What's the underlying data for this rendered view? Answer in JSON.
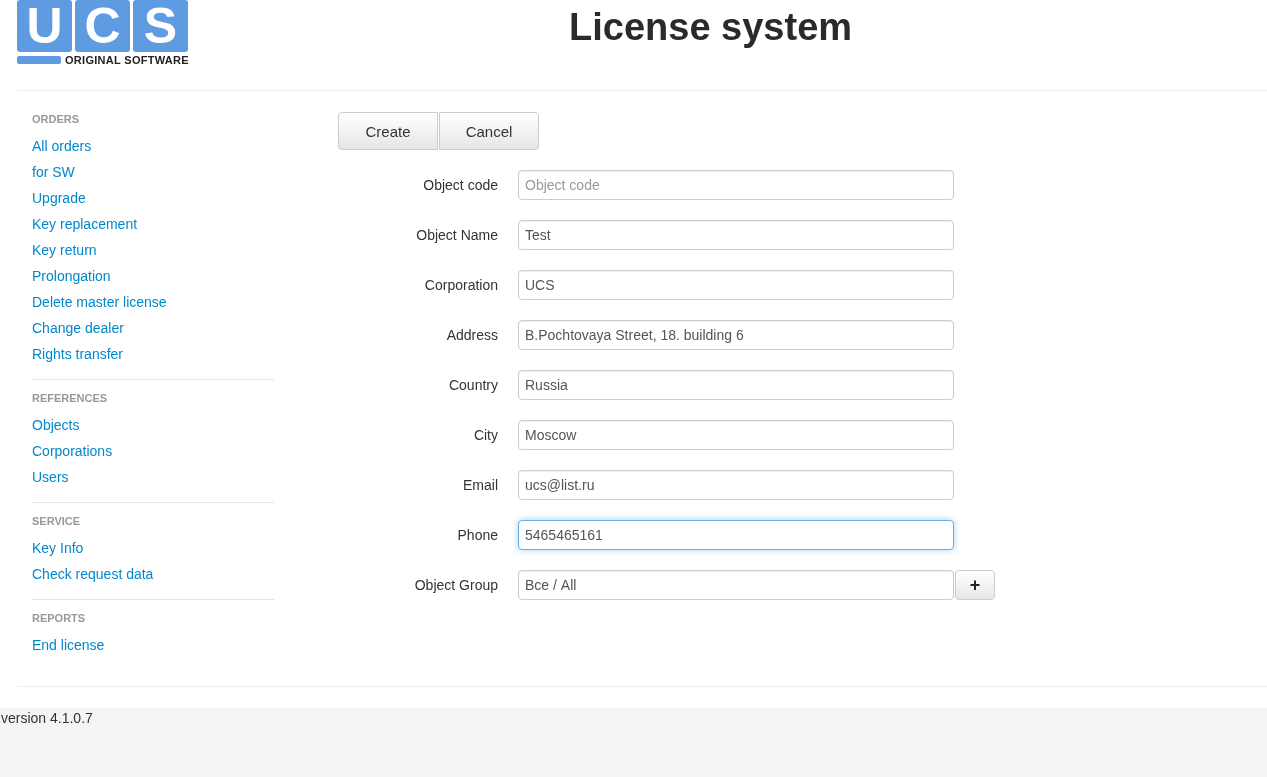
{
  "logo": {
    "letters": [
      "U",
      "C",
      "S"
    ],
    "tagline": "ORIGINAL SOFTWARE"
  },
  "title": "License system",
  "sidebar": {
    "sections": [
      {
        "heading": "ORDERS",
        "items": [
          "All orders",
          "for SW",
          "Upgrade",
          "Key replacement",
          "Key return",
          "Prolongation",
          "Delete master license",
          "Change dealer",
          "Rights transfer"
        ]
      },
      {
        "heading": "REFERENCES",
        "items": [
          "Objects",
          "Corporations",
          "Users"
        ]
      },
      {
        "heading": "SERVICE",
        "items": [
          "Key Info",
          "Check request data"
        ]
      },
      {
        "heading": "REPORTS",
        "items": [
          "End license"
        ]
      }
    ]
  },
  "buttons": [
    "Create",
    "Cancel"
  ],
  "form": [
    {
      "label": "Object code",
      "placeholder": "Object code",
      "focused": false
    },
    {
      "label": "Object Name",
      "value": "Test",
      "focused": false
    },
    {
      "label": "Corporation",
      "value": "UCS",
      "focused": false
    },
    {
      "label": "Address",
      "value": "B.Pochtovaya Street, 18. building 6",
      "focused": false
    },
    {
      "label": "Country",
      "value": "Russia",
      "focused": false
    },
    {
      "label": "City",
      "value": "Moscow",
      "focused": false
    },
    {
      "label": "Email",
      "value": "ucs@list.ru",
      "focused": false
    },
    {
      "label": "Phone",
      "value": "5465465161",
      "focused": true
    },
    {
      "label": "Object Group",
      "value": "Все / All",
      "focused": false,
      "add_button": "+"
    }
  ],
  "footer": {
    "version": "version 4.1.0.7"
  }
}
